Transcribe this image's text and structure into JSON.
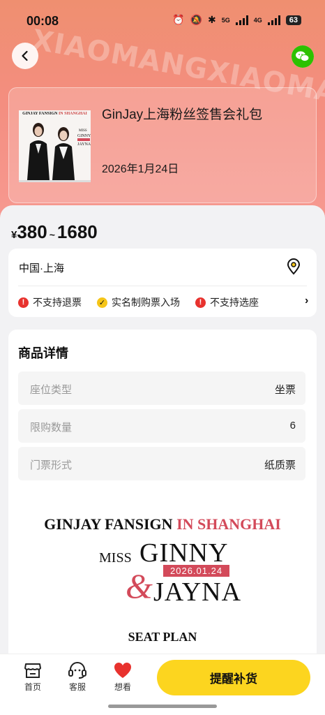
{
  "status_bar": {
    "time": "00:08",
    "network_1": "5G",
    "network_2": "4G",
    "battery": "63"
  },
  "header": {
    "watermark": "XIAOMANGXIAOMA"
  },
  "event": {
    "title": "GinJay上海粉丝签售会礼包",
    "date": "2026年1月24日",
    "poster_title_a": "GINJAY FANSIGN ",
    "poster_title_b": "IN SHANGHAI"
  },
  "price": {
    "currency": "¥",
    "min": "380",
    "separator": "~",
    "max": "1680"
  },
  "location": {
    "city": "中国·上海"
  },
  "policies": [
    {
      "label": "不支持退票",
      "icon": "exclamation-icon",
      "color": "#e8322e"
    },
    {
      "label": "实名制购票入场",
      "icon": "check-icon",
      "color": "#f5c518"
    },
    {
      "label": "不支持选座",
      "icon": "exclamation-icon",
      "color": "#e8322e"
    }
  ],
  "details": {
    "title": "商品详情",
    "rows": [
      {
        "key": "座位类型",
        "value": "坐票"
      },
      {
        "key": "限购数量",
        "value": "6"
      },
      {
        "key": "门票形式",
        "value": "纸质票"
      }
    ]
  },
  "poster": {
    "line1_a": "GINJAY FANSIGN ",
    "line1_b": "IN SHANGHAI",
    "miss": "MISS",
    "name1": "GINNY",
    "date": "2026.01.24",
    "amp": "&",
    "name2": "JAYNA",
    "seat_plan": "SEAT PLAN"
  },
  "bottom_nav": {
    "home": "首页",
    "service": "客服",
    "want": "想看",
    "cta": "提醒补货"
  },
  "colors": {
    "accent": "#fcd51f",
    "brand_red": "#d34a5a",
    "alert_red": "#e8322e"
  }
}
